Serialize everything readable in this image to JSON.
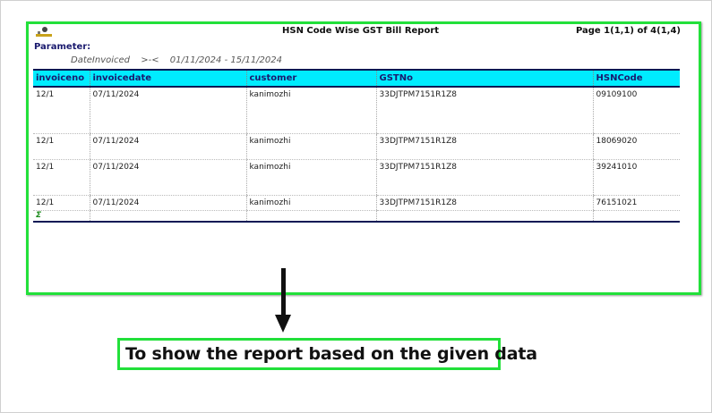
{
  "report": {
    "title": "HSN Code Wise GST Bill Report",
    "page_info": "Page 1(1,1) of 4(1,4)",
    "parameter_label": "Parameter:",
    "parameter": {
      "field": "DateInvoiced",
      "operator": ">-<",
      "value": "01/11/2024 - 15/11/2024"
    },
    "columns": [
      "invoiceno",
      "invoicedate",
      "customer",
      "GSTNo",
      "HSNCode"
    ],
    "rows": [
      {
        "invoiceno": "12/1",
        "invoicedate": "07/11/2024",
        "customer": "kanimozhi",
        "gstno": "33DJTPM7151R1Z8",
        "hsncode": "09109100"
      },
      {
        "invoiceno": "12/1",
        "invoicedate": "07/11/2024",
        "customer": "kanimozhi",
        "gstno": "33DJTPM7151R1Z8",
        "hsncode": "18069020"
      },
      {
        "invoiceno": "12/1",
        "invoicedate": "07/11/2024",
        "customer": "kanimozhi",
        "gstno": "33DJTPM7151R1Z8",
        "hsncode": "39241010"
      },
      {
        "invoiceno": "12/1",
        "invoicedate": "07/11/2024",
        "customer": "kanimozhi",
        "gstno": "33DJTPM7151R1Z8",
        "hsncode": "76151021"
      }
    ],
    "summary_symbol": "Σ"
  },
  "annotation": {
    "caption": "To show the report based on the given data",
    "highlight_color": "#22e03a",
    "arrow_icon": "down-arrow-icon"
  },
  "colors": {
    "header_bg": "#00ecff",
    "header_text": "#1a1a6e",
    "rule": "#0b1a55"
  }
}
